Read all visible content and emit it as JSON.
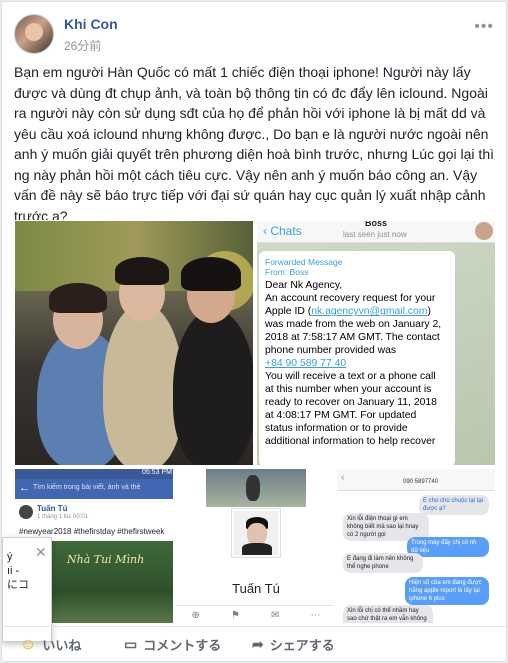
{
  "post": {
    "author": "Khi Con",
    "time": "26分前",
    "more": "•••",
    "text": "Bạn em người Hàn Quốc có mất 1 chiếc điện thoại iphone! Người này lấy được và dùng đt chụp ảnh, và toàn bộ thông tin có đc đẩy lên iclound. Ngoài ra người này còn sử dụng sđt của họ để phản hồi với iphone là bị mất dd và yêu cầu xoá iclound nhưng không được., Do bạn e là người nước ngoài nên anh ý muốn giải quyết trên phương diện hoà bình trước, nhưng Lúc gọi lại thì ng này phản hồi một cách tiêu cực. Vậy nên anh ý muốn báo công an. Vậy vấn đề này sẽ báo trực tiếp với đại sứ quán hay cục quản lý xuất nhập cảnh trước ạ?"
  },
  "chat": {
    "back": "Chats",
    "name": "Boss",
    "status": "last seen just now",
    "fwd_label": "Forwarded Message",
    "fwd_from": "From: Boss",
    "greeting": "Dear Nk Agency,",
    "l1": "An account recovery request for your",
    "l2a": "Apple ID (",
    "email": "nk.agencyvn@gmail.com",
    "l2b": ")",
    "l3": "was made from the web on January 2,",
    "l4": "2018 at 7:58:17 AM GMT. The contact",
    "l5": "phone number provided was",
    "phone": "+84 90 589 77 40",
    "l6": "You will receive a text or a phone call",
    "l7": "at this number when your account is",
    "l8": "ready to recover on January 11, 2018",
    "l9": "at 4:08:17 PM GMT. For updated",
    "l10": "status information or to provide",
    "l11": "additional information to help recover"
  },
  "fb_small": {
    "status_time": "05:53 PM",
    "search": "Tìm kiếm trong bài viết, ảnh và thẻ",
    "name": "Tuấn Tú",
    "sub": "1 tháng 1 lúc 00:01 ·",
    "tags": "#newyear2018 #thefirstday #thefirstweek",
    "sign": "Nhà Tui Mình"
  },
  "profile": {
    "name": "Tuấn Tú"
  },
  "sms": {
    "number": "090 5897740",
    "m1": "E cho chú chuộc lại tại được ạ?",
    "m2": "Xin lỗi điện thoại gì em không biết mà sao lại hnay có 2 người gọi",
    "m3": "Trong máy đấy chị có nh dữ liệu",
    "m4": "E đang đi làm nên không thể nghe phone",
    "m5": "Hiện số của em đang được hãng apple report là lấy tại iphone 6 plus",
    "m6": "Xin lỗi chị có thể nhầm hay sao chứ thật ra em vẫn không biết là điện"
  },
  "popup": {
    "l1": "ý",
    "l2": "ıi -",
    "l3": "にコ"
  },
  "actions": {
    "like": "いいね",
    "comment": "コメントする",
    "share": "シェアする"
  },
  "colors": {
    "link": "#365899",
    "accent": "#4267b2",
    "telegram": "#3e9ed6"
  }
}
